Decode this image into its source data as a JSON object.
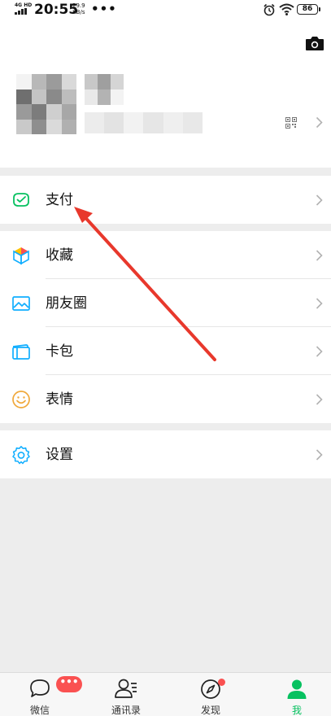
{
  "status_bar": {
    "network": "4G HD",
    "time": "20:55",
    "speed_value": "29.9",
    "speed_unit": "KB/s",
    "more": "•••",
    "battery": "86"
  },
  "profile": {
    "camera_icon": "camera-icon",
    "qr_icon": "qrcode-icon"
  },
  "menu": {
    "pay": {
      "label": "支付",
      "icon": "wallet-check-icon"
    },
    "favorites": {
      "label": "收藏",
      "icon": "cube-icon"
    },
    "moments": {
      "label": "朋友圈",
      "icon": "picture-icon"
    },
    "cards": {
      "label": "卡包",
      "icon": "card-icon"
    },
    "stickers": {
      "label": "表情",
      "icon": "smile-icon"
    },
    "settings": {
      "label": "设置",
      "icon": "gear-icon"
    }
  },
  "tabs": [
    {
      "label": "微信",
      "badge": "•••"
    },
    {
      "label": "通讯录"
    },
    {
      "label": "发现"
    },
    {
      "label": "我"
    }
  ],
  "colors": {
    "accent": "#07c160",
    "badge": "#fa5151",
    "annotation_arrow": "#e8382c"
  }
}
